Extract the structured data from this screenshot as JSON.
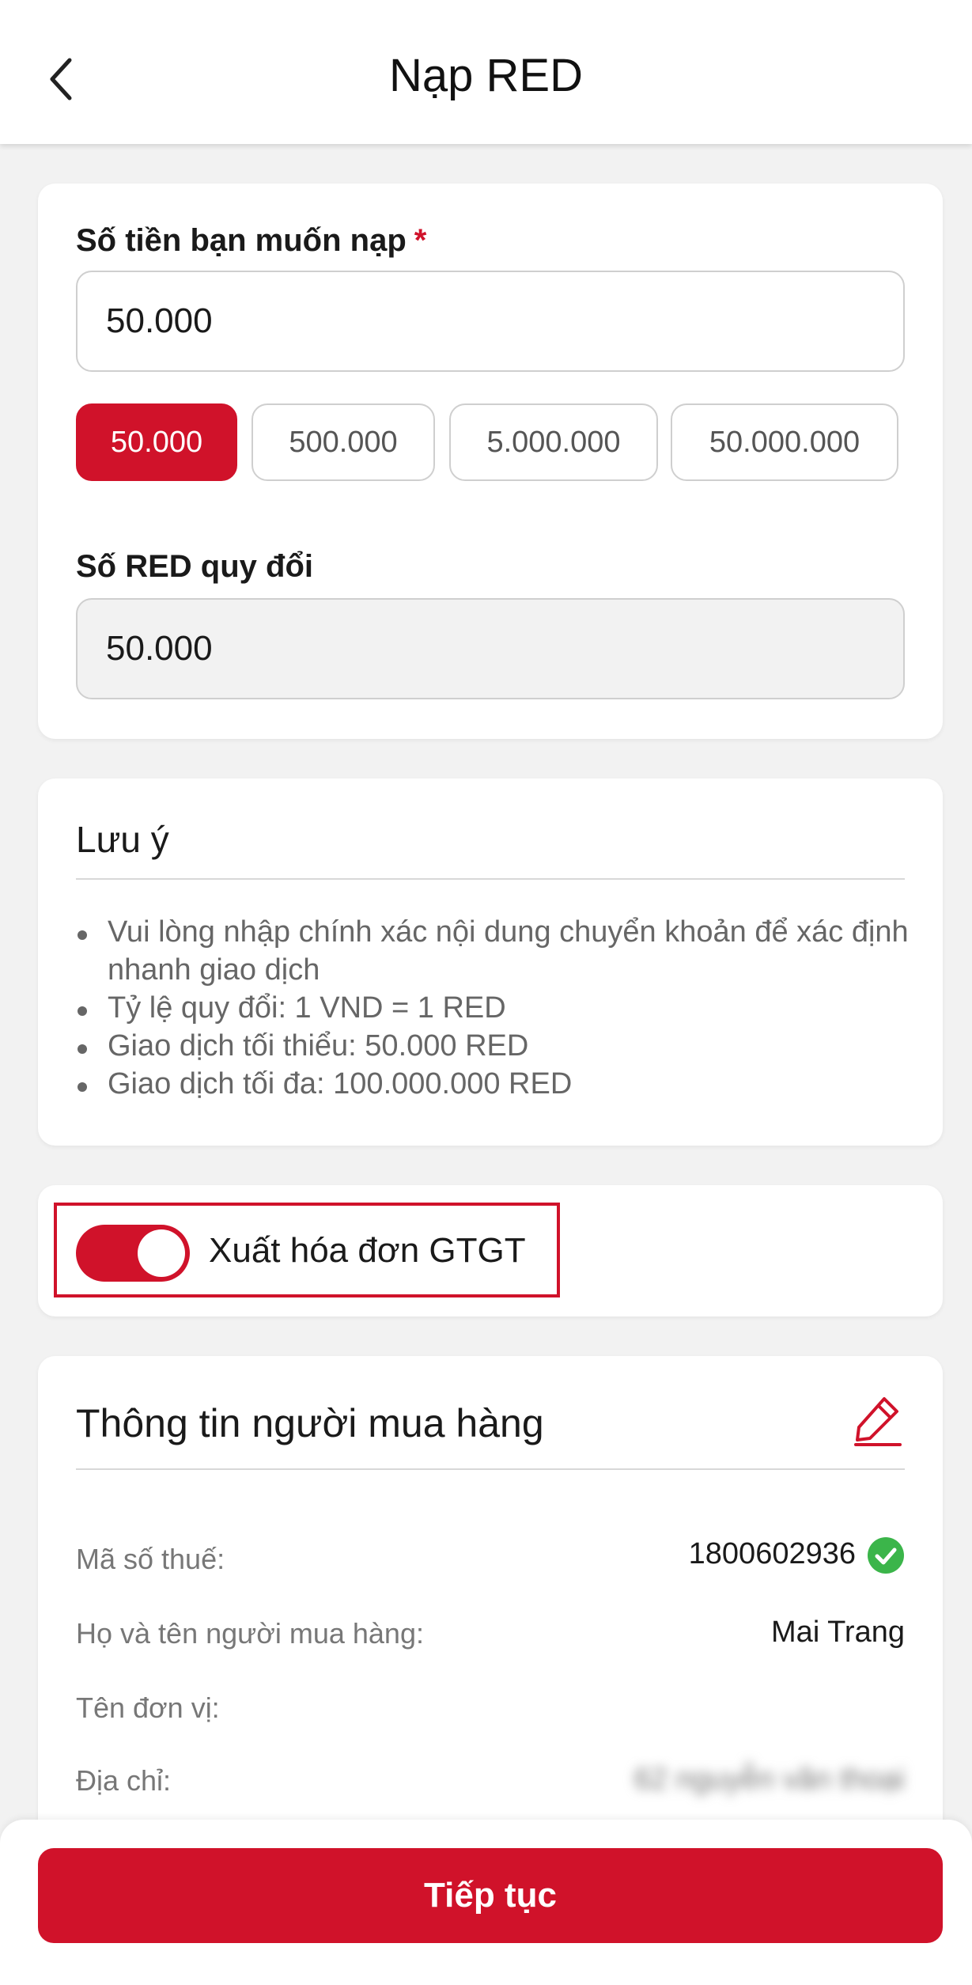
{
  "header": {
    "title": "Nạp RED",
    "back_icon": "chevron-left-icon"
  },
  "amount_card": {
    "amount_label": "Số tiền bạn muốn nạp",
    "required_mark": "*",
    "amount_value": "50.000",
    "quick_amounts": [
      {
        "label": "50.000",
        "selected": true
      },
      {
        "label": "500.000",
        "selected": false
      },
      {
        "label": "5.000.000",
        "selected": false
      },
      {
        "label": "50.000.000",
        "selected": false
      }
    ],
    "red_label": "Số RED quy đổi",
    "red_value": "50.000"
  },
  "notes": {
    "title": "Lưu ý",
    "items": [
      "Vui lòng nhập chính xác nội dung chuyển khoản để xác định nhanh giao dịch",
      "Tỷ lệ quy đổi: 1 VND = 1 RED",
      "Giao dịch tối thiểu: 50.000 RED",
      "Giao dịch tối đa: 100.000.000 RED"
    ]
  },
  "invoice": {
    "toggle_on": true,
    "label": "Xuất hóa đơn GTGT"
  },
  "buyer": {
    "title": "Thông tin người mua hàng",
    "edit_icon": "pencil-icon",
    "rows": [
      {
        "label": "Mã số thuế:",
        "value": "1800602936",
        "verified_icon": "check-circle-icon"
      },
      {
        "label": "Họ và tên người mua hàng:",
        "value": "Mai Trang"
      },
      {
        "label": "Tên đơn vị:",
        "value": ""
      },
      {
        "label": "Địa chỉ:",
        "value": "62 nguyễn văn thoại"
      }
    ]
  },
  "footer": {
    "continue_label": "Tiếp tục"
  },
  "colors": {
    "primary": "#d0122a",
    "verified": "#3bb54a",
    "background": "#f2f2f2"
  }
}
